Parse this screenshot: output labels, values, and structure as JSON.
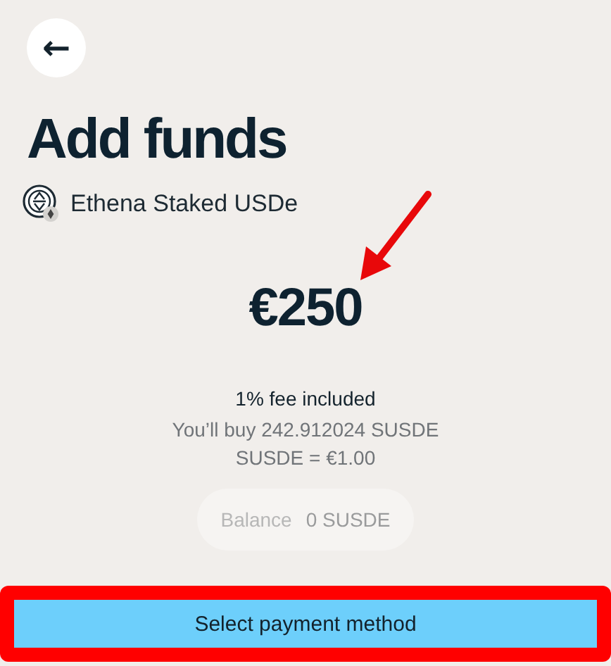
{
  "back_button": {
    "label": "←"
  },
  "title": "Add funds",
  "asset": {
    "name": "Ethena Staked USDe"
  },
  "amount": "€250",
  "fee_note": "1% fee included",
  "quote": [
    "You’ll buy 242.912024 SUSDE",
    "SUSDE = €1.00"
  ],
  "balance": {
    "label": "Balance",
    "value": "0 SUSDE"
  },
  "primary_button": {
    "label": "Select payment method",
    "highlighted": true
  },
  "annotation_arrow": true
}
